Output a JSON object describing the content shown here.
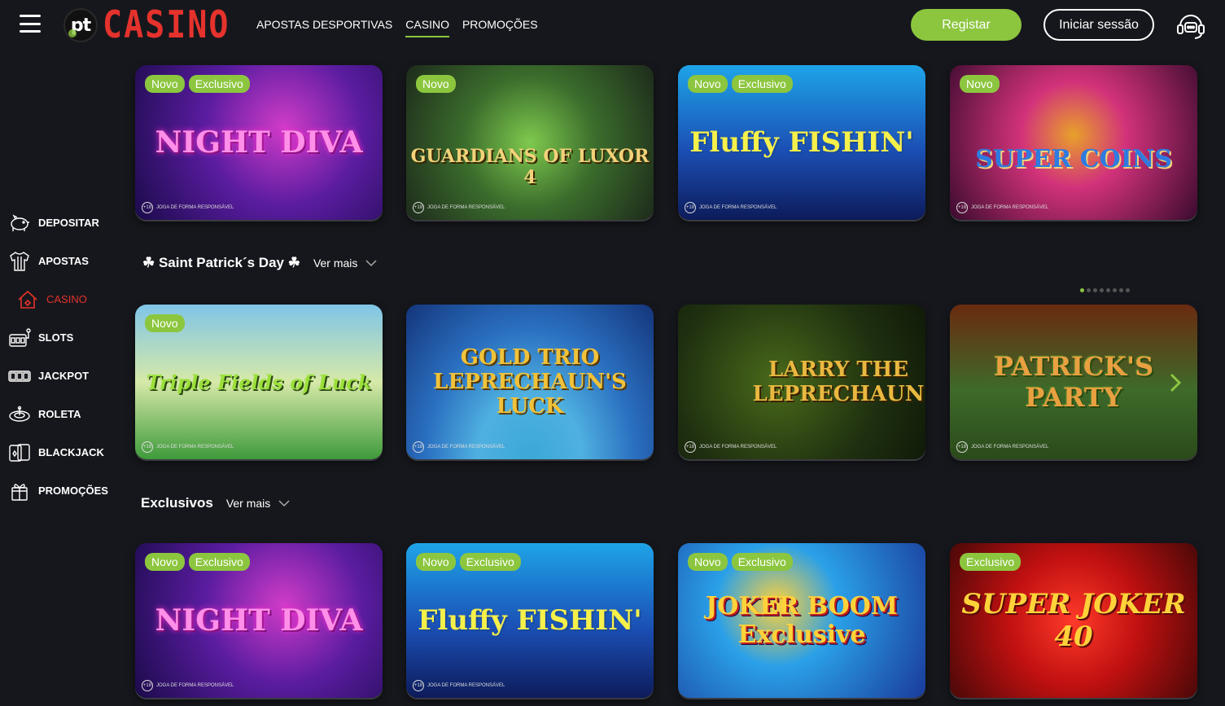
{
  "header": {
    "logo_mark": "pt",
    "logo_word": "CASINO",
    "nav": [
      "APOSTAS DESPORTIVAS",
      "CASINO",
      "PROMOÇÕES"
    ],
    "active_nav": "CASINO",
    "register_label": "Registar",
    "login_label": "Iniciar sessão"
  },
  "sidebar": {
    "items": [
      {
        "label": "DEPOSITAR",
        "icon": "piggy-bank-icon"
      },
      {
        "label": "APOSTAS",
        "icon": "jersey-icon"
      },
      {
        "label": "CASINO",
        "icon": "house-icon",
        "active": true
      },
      {
        "label": "SLOTS",
        "icon": "slot-machine-icon"
      },
      {
        "label": "JACKPOT",
        "icon": "jackpot-icon"
      },
      {
        "label": "ROLETA",
        "icon": "roulette-icon"
      },
      {
        "label": "BLACKJACK",
        "icon": "cards-icon"
      },
      {
        "label": "PROMOÇÕES",
        "icon": "gift-icon"
      }
    ]
  },
  "disclaimer": "JOGA DE FORMA RESPONSÁVEL",
  "age": "+18",
  "rows": [
    {
      "title": "",
      "games": [
        {
          "name": "NIGHT DIVA",
          "badges": [
            "Novo",
            "Exclusivo"
          ]
        },
        {
          "name": "GUARDIANS OF LUXOR 4",
          "badges": [
            "Novo"
          ]
        },
        {
          "name": "Fluffy FISHIN'",
          "badges": [
            "Novo",
            "Exclusivo"
          ]
        },
        {
          "name": "SUPER COINS",
          "badges": [
            "Novo"
          ]
        }
      ]
    },
    {
      "title": "☘ Saint Patrick´s Day ☘",
      "more": "Ver mais",
      "games": [
        {
          "name": "Triple Fields of Luck",
          "badges": [
            "Novo"
          ]
        },
        {
          "name": "GOLD TRIO LEPRECHAUN'S LUCK",
          "badges": []
        },
        {
          "name": "LARRY THE LEPRECHAUN",
          "badges": []
        },
        {
          "name": "PATRICK'S PARTY",
          "badges": []
        }
      ]
    },
    {
      "title": "Exclusivos",
      "more": "Ver mais",
      "games": [
        {
          "name": "NIGHT DIVA",
          "badges": [
            "Novo",
            "Exclusivo"
          ]
        },
        {
          "name": "Fluffy FISHIN'",
          "badges": [
            "Novo",
            "Exclusivo"
          ]
        },
        {
          "name": "JOKER BOOM Exclusive",
          "badges": [
            "Novo",
            "Exclusivo"
          ]
        },
        {
          "name": "SUPER JOKER 40",
          "badges": [
            "Exclusivo"
          ]
        }
      ]
    }
  ],
  "carousel": {
    "pages": 8,
    "current": 1
  },
  "colors": {
    "accent": "#8cc63f",
    "brand": "#e5322d",
    "background": "#16171c"
  }
}
